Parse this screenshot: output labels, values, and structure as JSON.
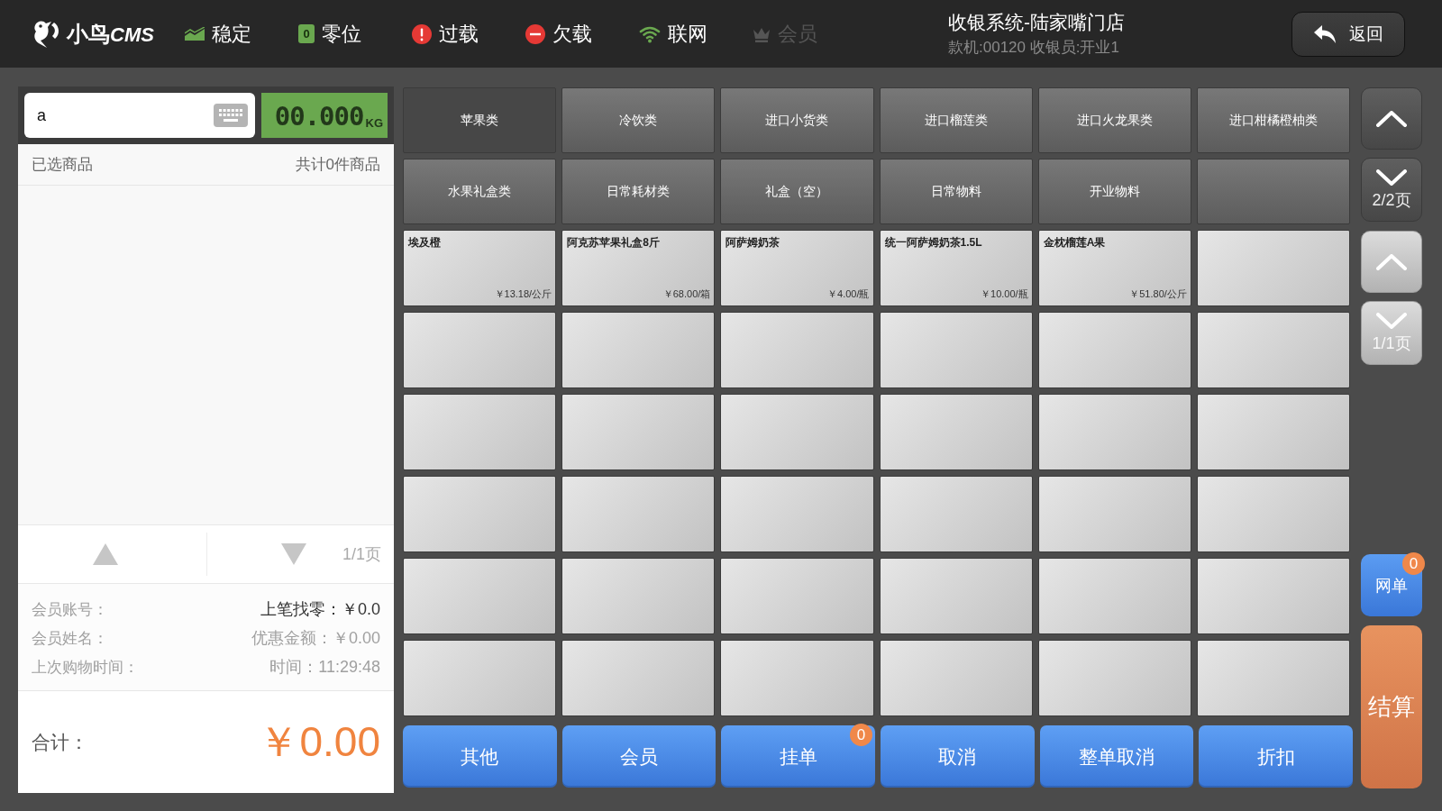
{
  "logo": {
    "name": "小鸟",
    "suffix": "CMS"
  },
  "statuses": [
    {
      "kind": "stable",
      "label": "稳定",
      "disabled": false
    },
    {
      "kind": "zero",
      "label": "零位",
      "icon_text": "0",
      "disabled": false
    },
    {
      "kind": "overload",
      "label": "过载",
      "disabled": false
    },
    {
      "kind": "underload",
      "label": "欠载",
      "disabled": false
    },
    {
      "kind": "network",
      "label": "联网",
      "disabled": false
    },
    {
      "kind": "member",
      "label": "会员",
      "disabled": true
    }
  ],
  "store": {
    "title": "收银系统-陆家嘴门店",
    "subtitle": "款机:00120 收银员:开业1"
  },
  "back_button": {
    "label": "返回"
  },
  "search": {
    "value": "a"
  },
  "scale": {
    "reading": "00.000",
    "unit": "KG"
  },
  "cart": {
    "title": "已选商品",
    "count": "共计0件商品",
    "page": "1/1页"
  },
  "member_info": [
    {
      "label": "会员账号：",
      "value": "上笔找零：￥0.0",
      "strong": true
    },
    {
      "label": "会员姓名：",
      "value": "优惠金额：￥0.00",
      "strong": false
    },
    {
      "label": "上次购物时间：",
      "value": "时间：11:29:48",
      "strong": false
    }
  ],
  "total": {
    "label": "合计：",
    "amount": "￥0.00"
  },
  "categories": [
    {
      "label": "苹果类",
      "selected": true
    },
    {
      "label": "冷饮类",
      "selected": false
    },
    {
      "label": "进口小货类",
      "selected": false
    },
    {
      "label": "进口榴莲类",
      "selected": false
    },
    {
      "label": "进口火龙果类",
      "selected": false
    },
    {
      "label": "进口柑橘橙柚类",
      "selected": false
    },
    {
      "label": "水果礼盒类",
      "selected": false
    },
    {
      "label": "日常耗材类",
      "selected": false
    },
    {
      "label": "礼盒（空）",
      "selected": false
    },
    {
      "label": "日常物料",
      "selected": false
    },
    {
      "label": "开业物料",
      "selected": false
    }
  ],
  "products": [
    {
      "name": "埃及橙",
      "price": "￥13.18/公斤"
    },
    {
      "name": "阿克苏苹果礼盒8斤",
      "price": "￥68.00/箱"
    },
    {
      "name": "阿萨姆奶茶",
      "price": "￥4.00/瓶"
    },
    {
      "name": "统一阿萨姆奶茶1.5L",
      "price": "￥10.00/瓶"
    },
    {
      "name": "金枕榴莲A果",
      "price": "￥51.80/公斤"
    }
  ],
  "actions": [
    {
      "label": "其他"
    },
    {
      "label": "会员"
    },
    {
      "label": "挂单",
      "badge": "0"
    },
    {
      "label": "取消"
    },
    {
      "label": "整单取消"
    },
    {
      "label": "折扣"
    }
  ],
  "pagers": [
    {
      "kind": "category",
      "page": "2/2页"
    },
    {
      "kind": "product",
      "page": "1/1页"
    }
  ],
  "side_buttons": [
    {
      "kind": "online",
      "label": "网单",
      "badge": "0"
    },
    {
      "kind": "checkout",
      "label": "结算"
    }
  ]
}
